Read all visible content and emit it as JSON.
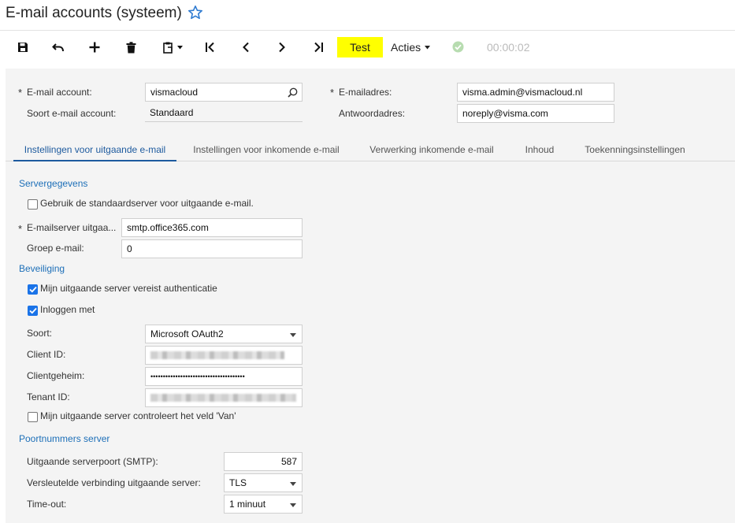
{
  "header": {
    "title": "E-mail accounts (systeem)"
  },
  "toolbar": {
    "test_label": "Test",
    "acties_label": "Acties",
    "timer": "00:00:02"
  },
  "account": {
    "email_account_label": "E-mail account:",
    "email_account_value": "vismacloud",
    "soort_label": "Soort e-mail account:",
    "soort_value": "Standaard",
    "emailadres_label": "E-mailadres:",
    "emailadres_value": "visma.admin@vismacloud.nl",
    "antwoordadres_label": "Antwoordadres:",
    "antwoordadres_value": "noreply@visma.com"
  },
  "tabs": [
    {
      "label": "Instellingen voor uitgaande e-mail"
    },
    {
      "label": "Instellingen voor inkomende e-mail"
    },
    {
      "label": "Verwerking inkomende e-mail"
    },
    {
      "label": "Inhoud"
    },
    {
      "label": "Toekenningsinstellingen"
    }
  ],
  "server": {
    "section": "Servergegevens",
    "default_server_label": "Gebruik de standaardserver voor uitgaande e-mail.",
    "smtp_label": "E-mailserver uitgaa...",
    "smtp_value": "smtp.office365.com",
    "group_label": "Groep e-mail:",
    "group_value": "0"
  },
  "security": {
    "section": "Beveiliging",
    "auth_label": "Mijn uitgaande server vereist authenticatie",
    "login_label": "Inloggen met",
    "soort_label": "Soort:",
    "soort_value": "Microsoft OAuth2",
    "client_id_label": "Client ID:",
    "client_secret_label": "Clientgeheim:",
    "client_secret_value": "••••••••••••••••••••••••••••••••••••••",
    "tenant_id_label": "Tenant ID:",
    "van_label": "Mijn uitgaande server controleert het veld 'Van'"
  },
  "ports": {
    "section": "Poortnummers server",
    "smtp_port_label": "Uitgaande serverpoort (SMTP):",
    "smtp_port_value": "587",
    "encryption_label": "Versleutelde verbinding uitgaande server:",
    "encryption_value": "TLS",
    "timeout_label": "Time-out:",
    "timeout_value": "1 minuut"
  }
}
